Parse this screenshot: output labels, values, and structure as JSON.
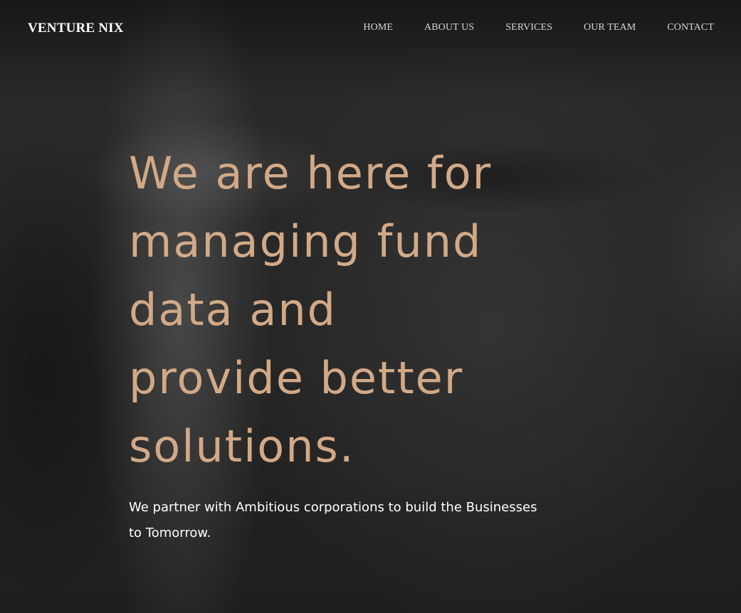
{
  "navbar": {
    "brand": "VENTURE NIX",
    "items": [
      {
        "label": "HOME"
      },
      {
        "label": "ABOUT US"
      },
      {
        "label": "SERVICES"
      },
      {
        "label": "OUR TEAM"
      },
      {
        "label": "CONTACT"
      }
    ]
  },
  "hero": {
    "title": "We are here for managing fund data and provide better solutions.",
    "subtitle": "We partner with Ambitious corporations to build the Businesses to Tomorrow."
  },
  "colors": {
    "accent": "#d2a987",
    "nav_text": "#d6d6d6",
    "background": "#1b1b1b"
  }
}
